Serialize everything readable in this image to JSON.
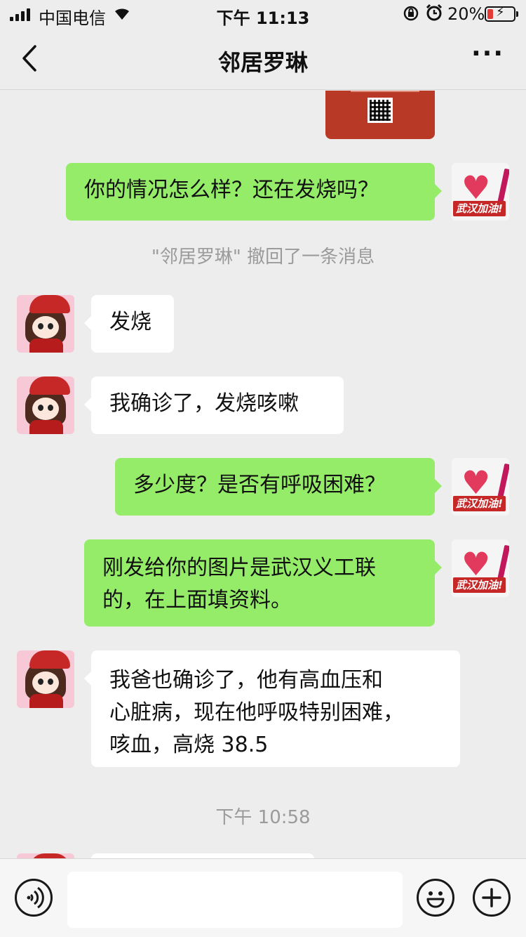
{
  "status_bar": {
    "carrier": "中国电信",
    "time": "下午 11:13",
    "battery_percent": "20%",
    "battery_level": 0.2,
    "icons": [
      "signal-icon",
      "wifi-icon",
      "orientation-lock-icon",
      "alarm-icon",
      "battery-charging-icon"
    ]
  },
  "nav": {
    "title": "邻居罗琳",
    "back_icon": "chevron-left-icon",
    "more_icon": "more-dots-icon",
    "more_glyph": "···"
  },
  "chat": {
    "messages": [
      {
        "from": "me",
        "text": "你的情况怎么样？还在发烧吗？"
      },
      {
        "from": "system",
        "text": "\"邻居罗琳\" 撤回了一条消息"
      },
      {
        "from": "them",
        "text": "发烧"
      },
      {
        "from": "them",
        "text": "我确诊了，发烧咳嗽"
      },
      {
        "from": "me",
        "text": "多少度？是否有呼吸困难？"
      },
      {
        "from": "me",
        "lines": [
          "刚发给你的图片是武汉义工联",
          "的，在上面填资料。"
        ]
      },
      {
        "from": "them",
        "lines": [
          "我爸也确诊了，他有高血压和",
          "心脏病，现在他呼吸特别困难，",
          "咳血，高烧 38.5"
        ]
      },
      {
        "from": "system",
        "text": "下午 10:58"
      }
    ],
    "my_avatar_tag": "武汉加油!",
    "colors": {
      "outgoing": "#95ec69",
      "incoming": "#ffffff",
      "background": "#ededed"
    }
  },
  "input_bar": {
    "placeholder": "",
    "value": "",
    "icons": [
      "voice-icon",
      "emoji-icon",
      "plus-icon"
    ]
  }
}
